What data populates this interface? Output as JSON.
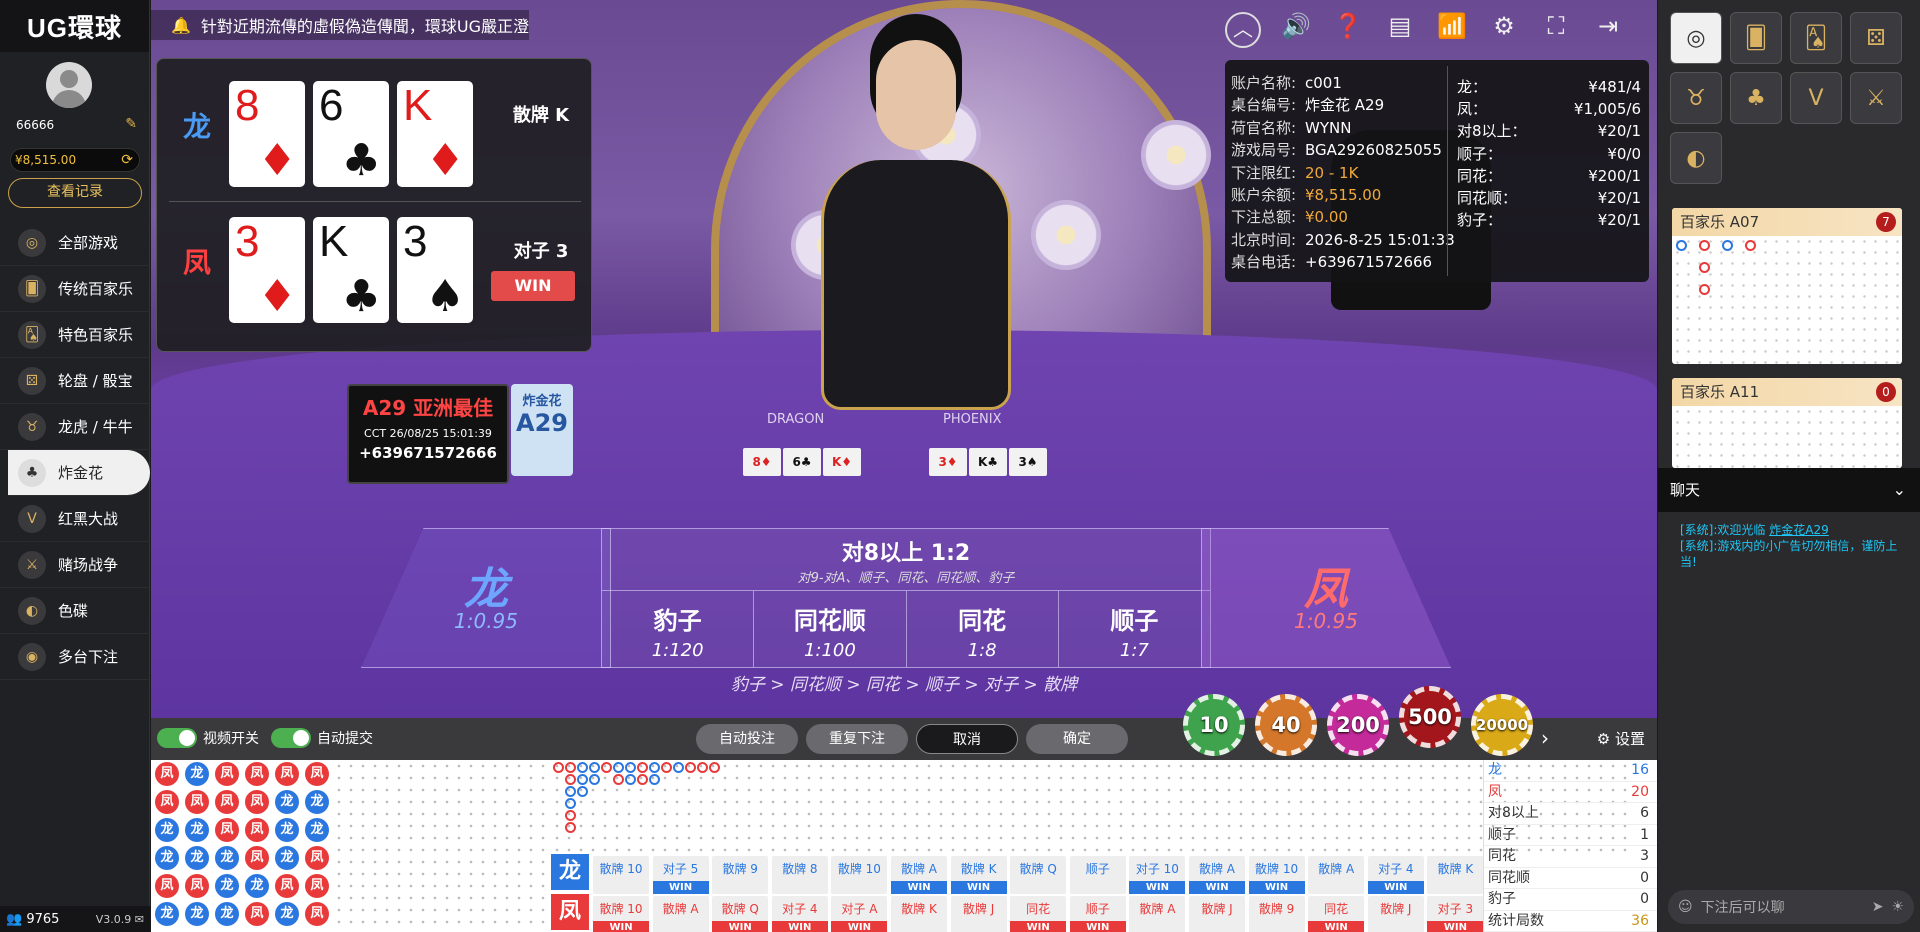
{
  "app": {
    "brand": "UG環球"
  },
  "user": {
    "name": "66666",
    "balance": "¥8,515.00",
    "records_label": "查看记录"
  },
  "nav": [
    {
      "label": "全部游戏",
      "icon": "all-games-icon",
      "glyph": "◎"
    },
    {
      "label": "传统百家乐",
      "icon": "baccarat-icon",
      "glyph": "🂠"
    },
    {
      "label": "特色百家乐",
      "icon": "special-baccarat-icon",
      "glyph": "🂡"
    },
    {
      "label": "轮盘 / 骰宝",
      "icon": "roulette-icon",
      "glyph": "⚄"
    },
    {
      "label": "龙虎 / 牛牛",
      "icon": "bull-icon",
      "glyph": "♉"
    },
    {
      "label": "炸金花",
      "icon": "golden-flower-icon",
      "glyph": "♣"
    },
    {
      "label": "红黑大战",
      "icon": "red-black-icon",
      "glyph": "V"
    },
    {
      "label": "赌场战争",
      "icon": "swords-icon",
      "glyph": "⚔"
    },
    {
      "label": "色碟",
      "icon": "sedie-icon",
      "glyph": "◐"
    },
    {
      "label": "多台下注",
      "icon": "multi-table-icon",
      "glyph": "◉"
    }
  ],
  "footer": {
    "online": "9765",
    "version": "V3.0.9"
  },
  "marquee": "针對近期流傳的虛假偽造傳聞，環球UG嚴正澄",
  "result": {
    "dragon": {
      "side": "龙",
      "cards": [
        {
          "r": "8",
          "s": "♦",
          "c": "red"
        },
        {
          "r": "6",
          "s": "♣",
          "c": "blk"
        },
        {
          "r": "K",
          "s": "♦",
          "c": "red"
        }
      ],
      "desc": "散牌 K"
    },
    "phoenix": {
      "side": "凤",
      "cards": [
        {
          "r": "3",
          "s": "♦",
          "c": "red"
        },
        {
          "r": "K",
          "s": "♣",
          "c": "blk"
        },
        {
          "r": "3",
          "s": "♠",
          "c": "blk"
        }
      ],
      "desc": "对子 3",
      "badge": "WIN"
    }
  },
  "info": {
    "left": [
      {
        "k": "账户名称:",
        "v": "c001"
      },
      {
        "k": "桌台编号:",
        "v": "炸金花 A29"
      },
      {
        "k": "荷官名称:",
        "v": "WYNN"
      },
      {
        "k": "游戏局号:",
        "v": "BGA29260825055"
      },
      {
        "k": "下注限红:",
        "v": "20 - 1K",
        "gold": true
      },
      {
        "k": "账户余额:",
        "v": "¥8,515.00",
        "gold": true
      },
      {
        "k": "下注总额:",
        "v": "¥0.00",
        "gold": true
      },
      {
        "k": "北京时间:",
        "v": "2026-8-25 15:01:33"
      },
      {
        "k": "桌台电话:",
        "v": "+639671572666"
      }
    ],
    "right": [
      {
        "k": "龙：",
        "v": "¥481/4"
      },
      {
        "k": "凤：",
        "v": "¥1,005/6"
      },
      {
        "k": "对8以上：",
        "v": "¥20/1"
      },
      {
        "k": "顺子：",
        "v": "¥0/0"
      },
      {
        "k": "同花：",
        "v": "¥200/1"
      },
      {
        "k": "同花顺：",
        "v": "¥20/1"
      },
      {
        "k": "豹子：",
        "v": "¥20/1"
      }
    ]
  },
  "felt": {
    "placard_title": "A29 亚洲最佳",
    "placard_time": "CCT 26/08/25 15:01:39",
    "placard_phone": "+639671572666",
    "placard2_top": "炸金花",
    "placard2_big": "A29",
    "dragon_label": "DRAGON",
    "phoenix_label": "PHOENIX",
    "dragon_cards": [
      {
        "t": "8♦",
        "c": "red"
      },
      {
        "t": "6♣",
        "c": "blk"
      },
      {
        "t": "K♦",
        "c": "red"
      }
    ],
    "phoenix_cards": [
      {
        "t": "3♦",
        "c": "red"
      },
      {
        "t": "K♣",
        "c": "blk"
      },
      {
        "t": "3♠",
        "c": "blk"
      }
    ]
  },
  "bets": {
    "dragon": {
      "name": "龙",
      "odds": "1:0.95"
    },
    "phoenix": {
      "name": "凤",
      "odds": "1:0.95"
    },
    "pair8": {
      "title": "对8以上 1:2",
      "sub": "对9-对A、顺子、同花、同花顺、豹子"
    },
    "cells": [
      {
        "name": "豹子",
        "odds": "1:120"
      },
      {
        "name": "同花顺",
        "odds": "1:100"
      },
      {
        "name": "同花",
        "odds": "1:8"
      },
      {
        "name": "顺子",
        "odds": "1:7"
      }
    ],
    "ranking": "豹子 > 同花顺 > 同花 > 顺子 > 对子 > 散牌"
  },
  "controls": {
    "video_toggle": "视频开关",
    "auto_submit": "自动提交",
    "auto_bet": "自动投注",
    "repeat": "重复下注",
    "cancel": "取消",
    "confirm": "确定",
    "settings": "设置",
    "chips": [
      {
        "v": "10",
        "color": "#3fa34d"
      },
      {
        "v": "40",
        "color": "#d4772a"
      },
      {
        "v": "200",
        "color": "#c42a9a"
      },
      {
        "v": "500",
        "color": "#a3161c"
      },
      {
        "v": "20000",
        "color": "#d9a918"
      }
    ]
  },
  "right_panel": {
    "rooms": [
      {
        "name": "百家乐 A07",
        "badge": "7"
      },
      {
        "name": "百家乐 A11",
        "badge": "0"
      }
    ],
    "chat_title": "聊天",
    "chat_msgs": [
      {
        "prefix": "[系统]:欢迎光临 ",
        "link": "炸金花A29"
      },
      {
        "prefix": "[系统]:游戏内的小广告切勿相信，谨防上当!",
        "link": ""
      }
    ],
    "chat_placeholder": "下注后可以聊"
  },
  "stats": [
    {
      "k": "龙",
      "v": "16",
      "kc": "#2a77e0",
      "vc": "#2a77e0"
    },
    {
      "k": "凤",
      "v": "20",
      "kc": "#e83a3a",
      "vc": "#e83a3a"
    },
    {
      "k": "对8以上",
      "v": "6"
    },
    {
      "k": "顺子",
      "v": "1"
    },
    {
      "k": "同花",
      "v": "3"
    },
    {
      "k": "同花顺",
      "v": "0"
    },
    {
      "k": "豹子",
      "v": "0"
    },
    {
      "k": "统计局数",
      "v": "36",
      "vc": "#c9961a"
    }
  ],
  "bead": [
    [
      "凤",
      "龙",
      "凤",
      "凤",
      "凤",
      "凤"
    ],
    [
      "凤",
      "凤",
      "凤",
      "凤",
      "龙",
      "龙"
    ],
    [
      "龙",
      "龙",
      "凤",
      "凤",
      "龙",
      "龙"
    ],
    [
      "龙",
      "龙",
      "龙",
      "凤",
      "龙",
      "凤"
    ],
    [
      "凤",
      "凤",
      "龙",
      "龙",
      "凤",
      "凤"
    ],
    [
      "龙",
      "龙",
      "龙",
      "凤",
      "龙",
      "凤"
    ]
  ],
  "history": {
    "dragon_label": "龙",
    "phoenix_label": "凤",
    "dragon": [
      {
        "t": "散牌 10",
        "w": ""
      },
      {
        "t": "对子 5",
        "w": "WIN"
      },
      {
        "t": "散牌 9",
        "w": ""
      },
      {
        "t": "散牌 8",
        "w": ""
      },
      {
        "t": "散牌 10",
        "w": ""
      },
      {
        "t": "散牌 A",
        "w": "WIN"
      },
      {
        "t": "散牌 K",
        "w": "WIN"
      },
      {
        "t": "散牌 Q",
        "w": ""
      },
      {
        "t": "顺子",
        "w": ""
      },
      {
        "t": "对子 10",
        "w": "WIN"
      },
      {
        "t": "散牌 A",
        "w": "WIN"
      },
      {
        "t": "散牌 10",
        "w": "WIN"
      },
      {
        "t": "散牌 A",
        "w": ""
      },
      {
        "t": "对子 4",
        "w": "WIN"
      },
      {
        "t": "散牌 K",
        "w": ""
      }
    ],
    "phoenix": [
      {
        "t": "散牌 10",
        "w": "WIN"
      },
      {
        "t": "散牌 A",
        "w": ""
      },
      {
        "t": "散牌 Q",
        "w": "WIN"
      },
      {
        "t": "对子 4",
        "w": "WIN"
      },
      {
        "t": "对子 A",
        "w": "WIN"
      },
      {
        "t": "散牌 K",
        "w": ""
      },
      {
        "t": "散牌 J",
        "w": ""
      },
      {
        "t": "同花",
        "w": "WIN"
      },
      {
        "t": "顺子",
        "w": "WIN"
      },
      {
        "t": "散牌 A",
        "w": ""
      },
      {
        "t": "散牌 J",
        "w": ""
      },
      {
        "t": "散牌 9",
        "w": ""
      },
      {
        "t": "同花",
        "w": "WIN"
      },
      {
        "t": "散牌 J",
        "w": ""
      },
      {
        "t": "对子 3",
        "w": "WIN"
      }
    ]
  }
}
